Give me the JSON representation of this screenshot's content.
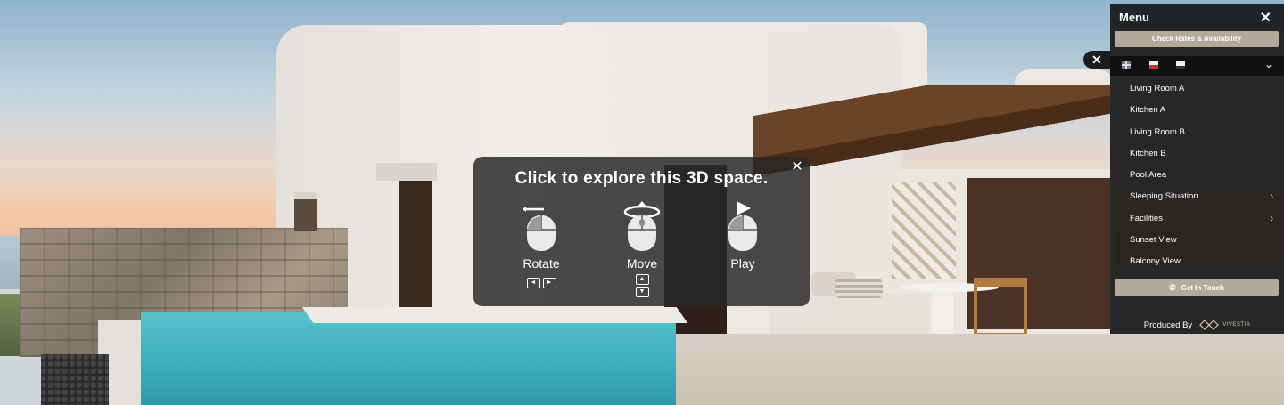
{
  "explore_overlay": {
    "title": "Click to explore this 3D space.",
    "close_icon": "close-icon",
    "controls": [
      {
        "label": "Rotate",
        "icon": "mouse-rotate-icon",
        "keys": [
          "left-arrow-key",
          "right-arrow-key"
        ]
      },
      {
        "label": "Move",
        "icon": "mouse-move-icon",
        "keys": [
          "up-arrow-key",
          "down-arrow-key"
        ]
      },
      {
        "label": "Play",
        "icon": "mouse-play-icon",
        "keys": []
      }
    ]
  },
  "menu": {
    "title": "Menu",
    "close_icon": "close-icon",
    "rates_button": "Check Rates & Availability",
    "languages": [
      "english-flag-icon",
      "other-flag-icon",
      "flag-icon"
    ],
    "items": [
      {
        "label": "Living Room A",
        "has_submenu": false
      },
      {
        "label": "Kitchen A",
        "has_submenu": false
      },
      {
        "label": "Living Room B",
        "has_submenu": false
      },
      {
        "label": "Kitchen B",
        "has_submenu": false
      },
      {
        "label": "Pool Area",
        "has_submenu": false
      },
      {
        "label": "Sleeping Situation",
        "has_submenu": true
      },
      {
        "label": "Facilities",
        "has_submenu": true
      },
      {
        "label": "Sunset View",
        "has_submenu": false
      },
      {
        "label": "Balcony View",
        "has_submenu": false
      }
    ],
    "contact_button": "Get In Touch",
    "produced_by": "Produced By",
    "brand": "VIVESTIA"
  },
  "colors": {
    "button_bg": "#b4aa9c",
    "menu_bg": "#181818",
    "overlay_bg": "#282828"
  }
}
